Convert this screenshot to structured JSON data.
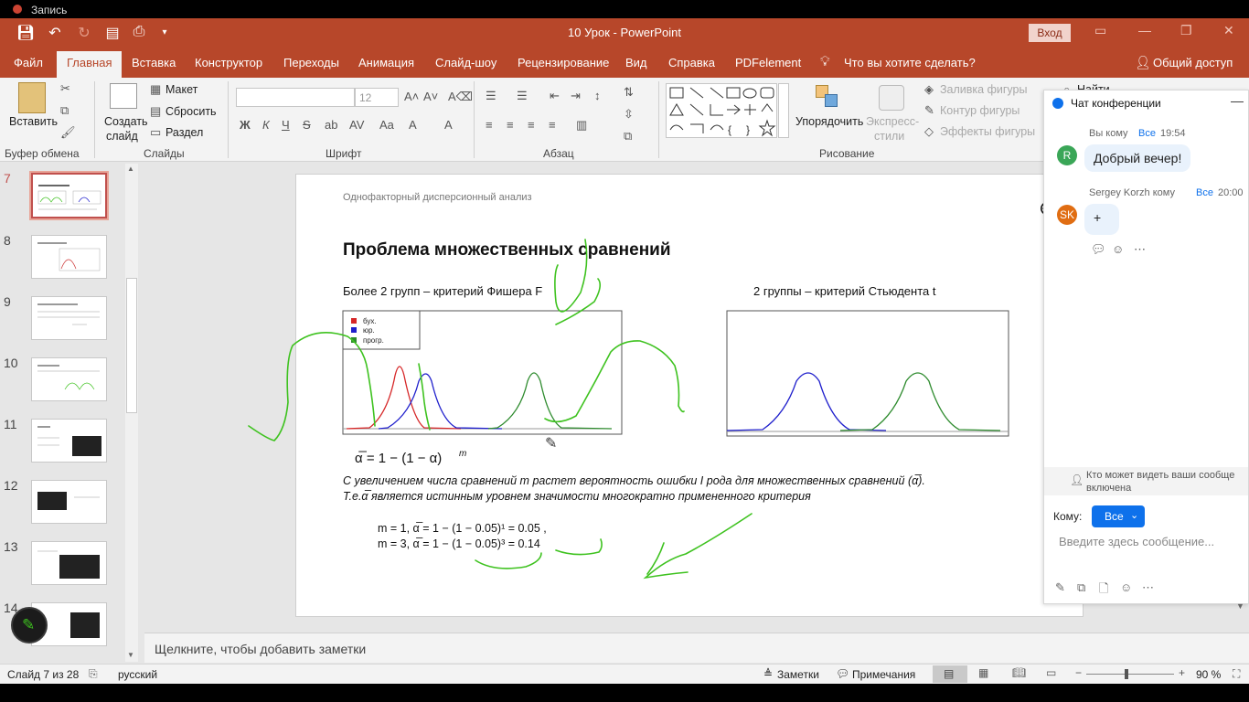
{
  "recorder": {
    "label": "Запись"
  },
  "titlebar": {
    "document_title": "10 Урок  -  PowerPoint",
    "login_label": "Вход"
  },
  "menu": {
    "items": [
      "Файл",
      "Главная",
      "Вставка",
      "Конструктор",
      "Переходы",
      "Анимация",
      "Слайд-шоу",
      "Рецензирование",
      "Вид",
      "Справка",
      "PDFelement"
    ],
    "tell_me": "Что вы хотите сделать?",
    "share": "Общий доступ"
  },
  "ribbon": {
    "paste_label": "Вставить",
    "clipboard_group": "Буфер обмена",
    "new_slide_line1": "Создать",
    "new_slide_line2": "слайд",
    "layout_label": "Макет",
    "reset_label": "Сбросить",
    "section_label": "Раздел",
    "slides_group": "Слайды",
    "font_size": "12",
    "font_group": "Шрифт",
    "paragraph_group": "Абзац",
    "arrange_label": "Упорядочить",
    "quick_styles_line1": "Экспресс-",
    "quick_styles_line2": "стили",
    "shape_fill": "Заливка фигуры",
    "shape_outline": "Контур фигуры",
    "shape_effects": "Эффекты фигуры",
    "drawing_group": "Рисование",
    "find_label": "Найти"
  },
  "thumbnails": [
    {
      "num": "7",
      "selected": true
    },
    {
      "num": "8"
    },
    {
      "num": "9"
    },
    {
      "num": "10"
    },
    {
      "num": "11"
    },
    {
      "num": "12"
    },
    {
      "num": "13"
    },
    {
      "num": "14"
    }
  ],
  "slide": {
    "header": "Однофакторный дисперсионный анализ",
    "title": "Проблема множественных сравнений",
    "left_caption": "Более 2 групп – критерий Фишера F",
    "right_caption": "2 группы – критерий Стьюдента t",
    "legend": [
      "бух.",
      "юр.",
      "прогр."
    ],
    "formula": "α̅ = 1 − (1 − α)",
    "formula_exp": "m",
    "text_line1": "С увеличением числа сравнений m растет вероятность ошибки I рода для множественных сравнений (α̅).",
    "text_line2": "Т.е.α̅ является истинным уровнем значимости многократно примененного критерия",
    "calc_line1": "m  = 1,  α̅ = 1 − (1 − 0.05)¹ = 0.05 ,",
    "calc_line2": "m  = 3,  α̅ = 1 − (1 − 0.05)³ = 0.14"
  },
  "notes_placeholder": "Щелкните, чтобы добавить заметки",
  "status": {
    "slide_info": "Слайд 7 из 28",
    "language": "русский",
    "notes": "Заметки",
    "comments": "Примечания",
    "zoom": "90 %"
  },
  "chat": {
    "title": "Чат конференции",
    "msg1": {
      "avatar": "R",
      "meta_prefix": "Вы кому",
      "to": "Все",
      "time": "19:54",
      "text": "Добрый вечер!"
    },
    "msg2": {
      "avatar": "SK",
      "meta_prefix": "Sergey Korzh кому",
      "to": "Все",
      "time": "20:00",
      "text": "+"
    },
    "visibility_note": "Кто может видеть ваши сообще включена",
    "to_label": "Кому:",
    "to_value": "Все",
    "input_placeholder": "Введите здесь сообщение..."
  },
  "colors": {
    "accent": "#b7472a",
    "series": [
      "#d62728",
      "#1f1fcc",
      "#2e8b2e"
    ],
    "annotation": "#3ec21f",
    "chat_blue": "#0e71eb"
  }
}
